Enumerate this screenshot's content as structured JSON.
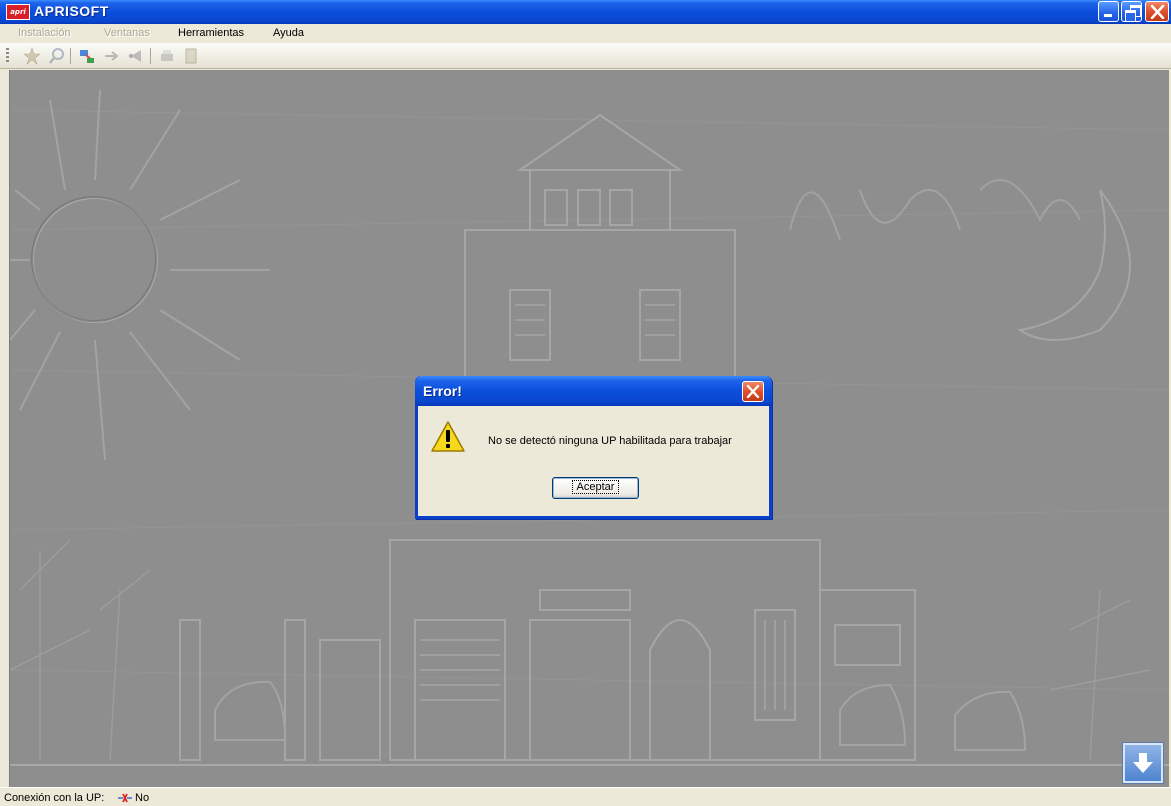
{
  "window": {
    "title": "APRISOFT",
    "icon": "aprisoft-logo-icon"
  },
  "menu": {
    "items": [
      {
        "label": "Instalación",
        "enabled": false
      },
      {
        "label": "Ventanas",
        "enabled": false
      },
      {
        "label": "Herramientas",
        "enabled": true
      },
      {
        "label": "Ayuda",
        "enabled": true
      }
    ]
  },
  "toolbar": {
    "icons": [
      "star-icon",
      "search-icon",
      "connect-icon",
      "arrow-right-icon",
      "broadcast-icon",
      "print-icon",
      "document-icon"
    ]
  },
  "dialog": {
    "title": "Error!",
    "message": "No se detectó ninguna UP habilitada para trabajar",
    "button_label": "Aceptar",
    "icon": "warning-icon"
  },
  "status": {
    "label": "Conexión con la UP:",
    "value": "No",
    "icon": "disconnected-icon"
  },
  "colors": {
    "titlebar": "#0b4fdc",
    "chrome": "#ece9d8",
    "background": "#8f8f8f"
  }
}
